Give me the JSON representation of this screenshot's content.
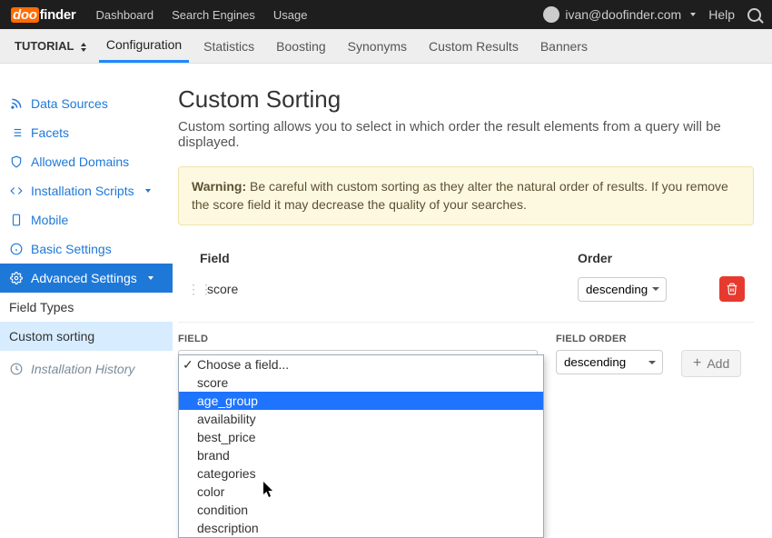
{
  "topbar": {
    "logo_prefix": "doo",
    "logo_suffix": "finder",
    "nav": [
      "Dashboard",
      "Search Engines",
      "Usage"
    ],
    "user": "ivan@doofinder.com",
    "help": "Help"
  },
  "tabbar": {
    "tutorial": "TUTORIAL",
    "tabs": [
      "Configuration",
      "Statistics",
      "Boosting",
      "Synonyms",
      "Custom Results",
      "Banners"
    ],
    "active_index": 0
  },
  "sidebar": {
    "items": [
      "Data Sources",
      "Facets",
      "Allowed Domains",
      "Installation Scripts",
      "Mobile",
      "Basic Settings",
      "Advanced Settings"
    ],
    "sub": [
      "Field Types",
      "Custom sorting"
    ],
    "history": "Installation History"
  },
  "page": {
    "title": "Custom Sorting",
    "subtitle": "Custom sorting allows you to select in which order the result elements from a query will be displayed.",
    "warning_label": "Warning:",
    "warning_text": "Be careful with custom sorting as they alter the natural order of results. If you remove the score field it may decrease the quality of your searches."
  },
  "table": {
    "col_field": "Field",
    "col_order": "Order",
    "row": {
      "field": "score",
      "order": "descending"
    }
  },
  "form": {
    "field_label": "FIELD",
    "order_label": "FIELD ORDER",
    "order_value": "descending",
    "add_label": "Add"
  },
  "dropdown": {
    "placeholder": "Choose a field...",
    "options": [
      "score",
      "age_group",
      "availability",
      "best_price",
      "brand",
      "categories",
      "color",
      "condition",
      "description"
    ],
    "highlighted_index": 1
  }
}
